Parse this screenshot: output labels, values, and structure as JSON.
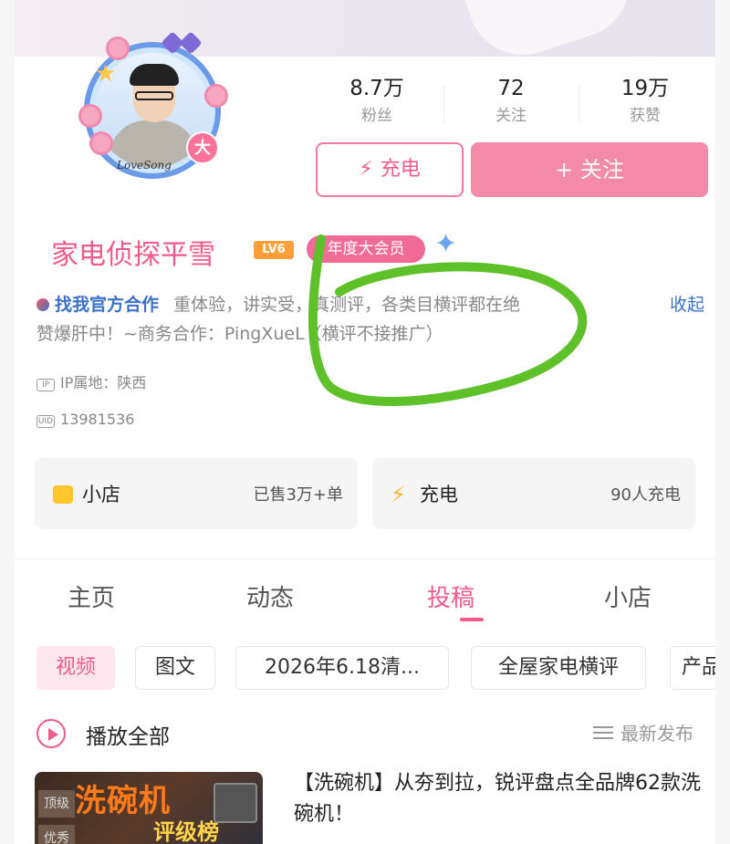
{
  "profile": {
    "username": "家电侦探平雪",
    "level": "LV6",
    "vip_label": "年度大会员",
    "avatar_badge": "大",
    "avatar_signature": "LoveSong"
  },
  "stats": [
    {
      "value": "8.7万",
      "label": "粉丝"
    },
    {
      "value": "72",
      "label": "关注"
    },
    {
      "value": "19万",
      "label": "获赞"
    }
  ],
  "actions": {
    "charge_label": "充电",
    "follow_label": "+ 关注"
  },
  "bio": {
    "partner_link": "找我官方合作",
    "line1": "重体验，讲实受，真测评，各类目横评都在绝",
    "line2": "赞爆肝中！~商务合作：PingXueL（横评不接推广）",
    "collapse_label": "收起"
  },
  "meta": {
    "ip_tag": "IP",
    "ip_location": "IP属地：陕西",
    "uid_tag": "UID",
    "uid": "13981536"
  },
  "panels": {
    "shop": {
      "title": "小店",
      "value": "已售3万+单"
    },
    "charge": {
      "title": "充电",
      "value": "90人充电"
    }
  },
  "tabs": [
    {
      "label": "主页"
    },
    {
      "label": "动态"
    },
    {
      "label": "投稿",
      "active": true
    },
    {
      "label": "小店"
    }
  ],
  "chips": [
    {
      "label": "视频",
      "active": true
    },
    {
      "label": "图文"
    },
    {
      "label": "2026年6.18清..."
    },
    {
      "label": "全屋家电横评"
    },
    {
      "label": "产品"
    }
  ],
  "playall_label": "播放全部",
  "sort_label": "最新发布",
  "video": {
    "title": "【洗碗机】从夯到拉，锐评盘点全品牌62款洗碗机！",
    "thumb_title": "洗碗机",
    "thumb_subtitle": "评级榜",
    "thumb_side_labels": [
      "顶级",
      "优秀"
    ]
  },
  "colors": {
    "accent": "#f05b8a",
    "follow_button": "#f48aa9",
    "link_blue": "#3b71c7",
    "annotation_green": "#5fc12a"
  },
  "icons": {
    "charge": "lightning-bolt-icon",
    "shop": "shop-bag-icon",
    "play": "play-circle-icon",
    "sort": "list-lines-icon",
    "ip": "ip-tag-icon",
    "uid": "uid-tag-icon"
  }
}
